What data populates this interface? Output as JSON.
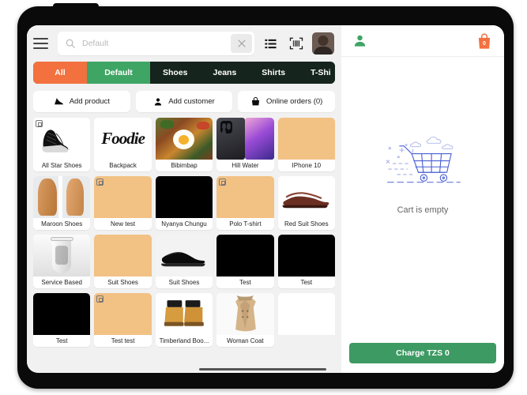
{
  "app": {
    "device": "tablet",
    "colors": {
      "accent_orange": "#f3703f",
      "accent_green": "#3fa564",
      "tab_dark": "#15241d",
      "charge_green": "#3d9a63",
      "cart_badge": "#f3703f",
      "illustration_blue": "#4a5fd4",
      "tile_tan": "#f2c184"
    }
  },
  "topbar": {
    "menu_icon": "hamburger-icon",
    "search": {
      "icon": "search-icon",
      "value": "",
      "placeholder": "Default",
      "clear_icon": "close-icon"
    },
    "list_view_icon": "list-view-icon",
    "barcode_icon": "barcode-scan-icon",
    "avatar_icon": "user-avatar"
  },
  "tabs": [
    {
      "label": "All",
      "style": "all",
      "active": true
    },
    {
      "label": "Default",
      "style": "default",
      "active": false
    },
    {
      "label": "Shoes",
      "style": "dark",
      "active": false
    },
    {
      "label": "Jeans",
      "style": "dark",
      "active": false
    },
    {
      "label": "Shirts",
      "style": "dark",
      "active": false
    },
    {
      "label": "T-Shi",
      "style": "dark",
      "active": false
    }
  ],
  "actions": [
    {
      "label": "Add product",
      "icon": "shoe-icon"
    },
    {
      "label": "Add customer",
      "icon": "person-icon"
    },
    {
      "label": "Online orders (0)",
      "icon": "basket-icon"
    }
  ],
  "products": [
    {
      "name": "All Star Shoes",
      "art": "sneaker",
      "badge": true
    },
    {
      "name": "Backpack",
      "art": "foodie-logo",
      "badge": false
    },
    {
      "name": "Bibimbap",
      "art": "bibimbap",
      "badge": false
    },
    {
      "name": "Hill Water",
      "art": "phones",
      "badge": false
    },
    {
      "name": "IPhone 10",
      "art": "tan",
      "badge": false
    },
    {
      "name": "Maroon Shoes",
      "art": "maroon-shoes",
      "badge": false
    },
    {
      "name": "New test",
      "art": "tan",
      "badge": true
    },
    {
      "name": "Nyanya Chungu",
      "art": "black",
      "badge": false
    },
    {
      "name": "Polo T-shirt",
      "art": "tan",
      "badge": true
    },
    {
      "name": "Red Suit Shoes",
      "art": "brown-loafers",
      "badge": false
    },
    {
      "name": "Service Based",
      "art": "coffee-cup",
      "badge": false
    },
    {
      "name": "Suit Shoes",
      "art": "tan",
      "badge": false
    },
    {
      "name": "Suit Shoes",
      "art": "black-dress-shoe",
      "badge": false
    },
    {
      "name": "Test",
      "art": "black",
      "badge": false
    },
    {
      "name": "Test",
      "art": "black",
      "badge": false
    },
    {
      "name": "Test",
      "art": "black",
      "badge": false
    },
    {
      "name": "Test test",
      "art": "tan",
      "badge": true
    },
    {
      "name": "Timberland Boo...",
      "art": "boots",
      "badge": false
    },
    {
      "name": "Woman Coat",
      "art": "coat",
      "badge": false
    },
    {
      "name": "",
      "art": "empty",
      "badge": false
    }
  ],
  "cart": {
    "customer_icon": "person-icon",
    "bag_icon": "shopping-bag-icon",
    "bag_count": "0",
    "illustration": "empty-cart-illustration",
    "empty_text": "Cart is empty",
    "charge_label": "Charge TZS 0"
  }
}
